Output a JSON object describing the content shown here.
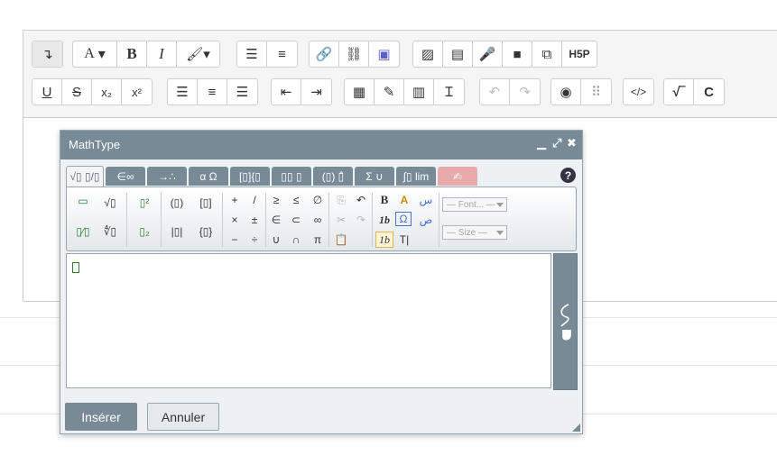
{
  "toolbar": {
    "row1": {
      "group_format": {
        "font_label": "A",
        "bold_label": "B",
        "italic_label": "I"
      },
      "h5p_label": "H5P"
    },
    "row2": {
      "underline_label": "U",
      "strike_label": "S",
      "subscript_label": "x₂",
      "superscript_label": "x²"
    }
  },
  "dialog": {
    "title": "MathType",
    "tabs": [
      {
        "label": "√▯ ▯/▯",
        "active": true
      },
      {
        "label": "∈∞",
        "active": false
      },
      {
        "label": "→∴",
        "active": false
      },
      {
        "label": "α Ω",
        "active": false
      },
      {
        "label": "[▯]{▯",
        "active": false
      },
      {
        "label": "▯▯ ▯",
        "active": false
      },
      {
        "label": "(▯) ▯̂",
        "active": false
      },
      {
        "label": "Σ ∪",
        "active": false
      },
      {
        "label": "∫▯ lim",
        "active": false
      },
      {
        "label": "✍",
        "active": false
      }
    ],
    "palette": {
      "font_placeholder": "— Font... —",
      "size_placeholder": "— Size —",
      "symbols_col1": [
        "+",
        "/",
        "×",
        "±",
        "−",
        "÷"
      ],
      "symbols_col2": [
        "≥",
        "≤",
        "∈",
        "⊂",
        "∪",
        "∩"
      ],
      "symbols_col3": [
        "∅",
        "∞",
        "π"
      ]
    },
    "buttons": {
      "insert": "Insérer",
      "cancel": "Annuler"
    },
    "help_label": "?"
  }
}
